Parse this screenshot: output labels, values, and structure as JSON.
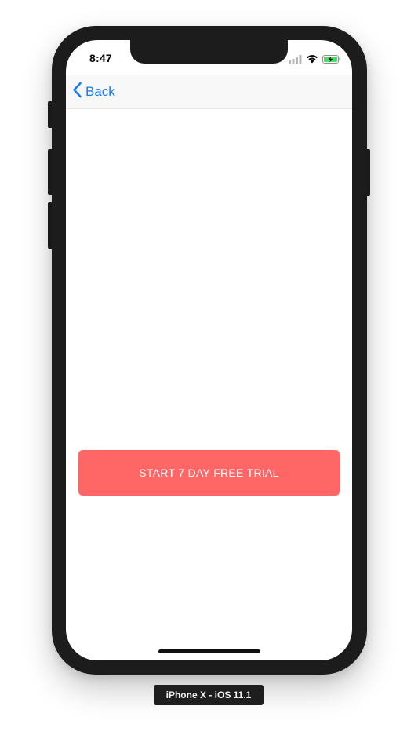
{
  "status_bar": {
    "time": "8:47",
    "icons": [
      "cellular-signal-icon",
      "wifi-icon",
      "battery-charging-icon"
    ]
  },
  "nav": {
    "back_label": "Back",
    "back_icon": "chevron-left-icon"
  },
  "main": {
    "cta_label": "START 7 DAY FREE TRIAL"
  },
  "simulator": {
    "device_label": "iPhone X - iOS 11.1"
  },
  "colors": {
    "accent": "#1a7cf5",
    "cta_background": "#ff6767",
    "battery_charge": "#4cd964"
  }
}
